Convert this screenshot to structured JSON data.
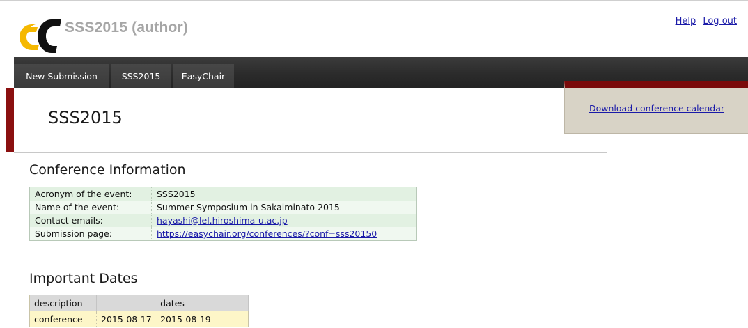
{
  "header": {
    "title": "SSS2015 (author)",
    "help_label": "Help",
    "logout_label": "Log out",
    "logo_color": "#f5b800"
  },
  "nav": {
    "items": [
      {
        "label": "New Submission"
      },
      {
        "label": "SSS2015"
      },
      {
        "label": "EasyChair"
      }
    ]
  },
  "page": {
    "title": "SSS2015",
    "download_link": "Download conference calendar"
  },
  "conference_info": {
    "heading": "Conference Information",
    "rows": [
      {
        "key": "Acronym of the event:",
        "value": "SSS2015"
      },
      {
        "key": "Name of the event:",
        "value": "Summer Symposium in Sakaiminato 2015"
      },
      {
        "key": "Contact emails:",
        "value": "hayashi@lel.hiroshima-u.ac.jp"
      },
      {
        "key": "Submission page:",
        "value": "https://easychair.org/conferences/?conf=sss20150"
      }
    ]
  },
  "important_dates": {
    "heading": "Important Dates",
    "columns": [
      "description",
      "dates"
    ],
    "rows": [
      {
        "description": "conference",
        "dates": "2015-08-17 - 2015-08-19"
      }
    ]
  },
  "colors": {
    "accent_red": "#8a0f0f",
    "link_blue": "#1a1aa8",
    "nav_dark": "#2b2b2b"
  }
}
